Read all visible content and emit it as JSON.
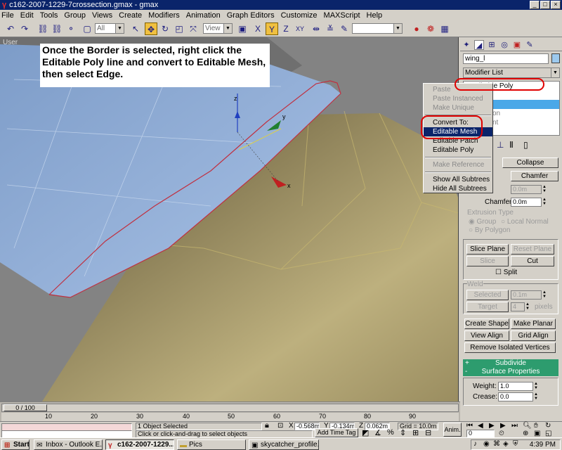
{
  "window": {
    "title": "c162-2007-1229-7crossection.gmax - gmax",
    "app_icon": "gmax-logo-icon",
    "buttons": [
      "_",
      "□",
      "×"
    ]
  },
  "menu": [
    "File",
    "Edit",
    "Tools",
    "Group",
    "Views",
    "Create",
    "Modifiers",
    "Animation",
    "Graph Editors",
    "Customize",
    "MAXScript",
    "Help"
  ],
  "toolbar": {
    "selection_filter": "All",
    "reference_coord": "View",
    "axis_x": "X",
    "axis_y": "Y",
    "axis_z": "Z",
    "axis_xy": "XY"
  },
  "viewport": {
    "label": "User",
    "gizmo_x": "x",
    "gizmo_y": "y",
    "gizmo_z": "z"
  },
  "annotation": {
    "text": "Once the Border is selected, right click the Editable Poly line and convert to Editable Mesh, then select Edge."
  },
  "context_menu": {
    "items": [
      {
        "label": "Paste",
        "state": "disabled"
      },
      {
        "label": "Paste Instanced",
        "state": "disabled"
      },
      {
        "label": "Make Unique",
        "state": "disabled"
      },
      {
        "label": "Convert To:",
        "state": "normal"
      },
      {
        "label": "Editable Mesh",
        "state": "selected"
      },
      {
        "label": "Editable Patch",
        "state": "normal"
      },
      {
        "label": "Editable Poly",
        "state": "normal"
      },
      {
        "label": "Make Reference",
        "state": "disabled"
      },
      {
        "label": "Show All Subtrees",
        "state": "normal"
      },
      {
        "label": "Hide All Subtrees",
        "state": "normal"
      }
    ]
  },
  "command_panel": {
    "object_name": "wing_l",
    "modifier_list": "Modifier List",
    "stack": [
      "Editable Poly",
      "",
      "",
      "",
      "",
      ""
    ],
    "stack_fragments": [
      "on",
      "nt"
    ],
    "buttons": {
      "collapse": "Collapse",
      "chamfer": "Chamfer",
      "slice_plane": "Slice Plane",
      "reset_plane": "Reset Plane",
      "slice": "Slice",
      "cut": "Cut",
      "selected": "Selected",
      "target": "Target",
      "create_shape": "Create Shape",
      "make_planar": "Make Planar",
      "view_align": "View Align",
      "grid_align": "Grid Align",
      "remove_isolated": "Remove Isolated Vertices"
    },
    "labels": {
      "chamfer": "Chamfer",
      "extrusion_type": "Extrusion Type",
      "group": "Group",
      "local_normal": "Local Normal",
      "by_polygon": "By Polygon",
      "split": "Split",
      "weld": "Weld",
      "pixels": "pixels",
      "weight": "Weight:",
      "crease": "Crease:"
    },
    "values": {
      "spin1": "0.0m",
      "chamfer": "0.0m",
      "weld_threshold": "0.1m",
      "target_pixels": "4",
      "weight": "1.0",
      "crease": "0.0"
    },
    "rollouts": {
      "subdivide": "Subdivide",
      "surface_properties": "Surface Properties"
    }
  },
  "timeline": {
    "frame": "0 / 100",
    "ticks": [
      "10",
      "20",
      "30",
      "40",
      "50",
      "60",
      "70",
      "80",
      "90"
    ]
  },
  "status": {
    "selection": "1 Object Selected",
    "prompt": "Click or click-and-drag to select objects",
    "x_label": "X",
    "x": "-0.568m",
    "y_label": "Y",
    "y": "-0.134m",
    "z_label": "Z",
    "z": "0.062m",
    "grid": "Grid = 10.0m",
    "add_time_tag": "Add Time Tag",
    "anim": "Anim.",
    "frame": "0"
  },
  "taskbar": {
    "start": "Start",
    "tasks": [
      "Inbox - Outlook E...",
      "c162-2007-1229...",
      "Pics",
      "skycatcher_profile...."
    ],
    "clock": "4:39 PM"
  },
  "colors": {
    "titlebar": "#0a246a",
    "highlight_oval": "#e00000",
    "rollout": "#2d9c6e",
    "stack_highlight": "#4aa8e8"
  }
}
